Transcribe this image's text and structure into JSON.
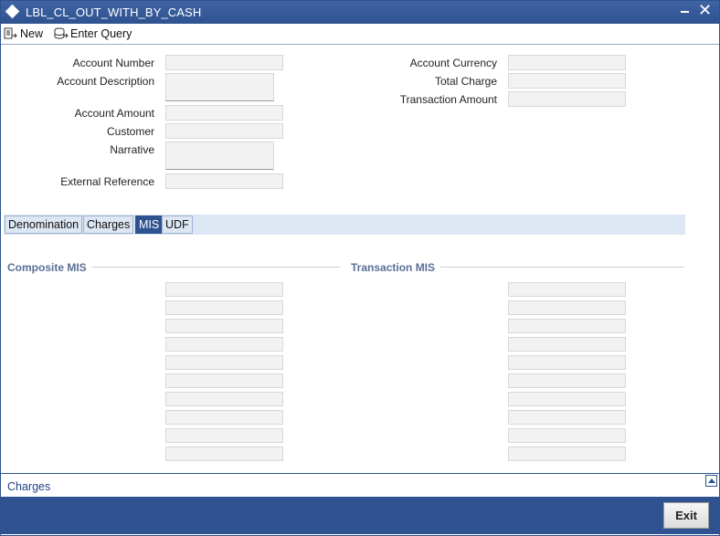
{
  "window": {
    "title": "LBL_CL_OUT_WITH_BY_CASH"
  },
  "toolbar": {
    "new_label": "New",
    "enter_query_label": "Enter Query"
  },
  "form": {
    "left": {
      "account_number": {
        "label": "Account Number",
        "value": ""
      },
      "account_description": {
        "label": "Account Description",
        "value": ""
      },
      "account_amount": {
        "label": "Account Amount",
        "value": ""
      },
      "customer": {
        "label": "Customer",
        "value": ""
      },
      "narrative": {
        "label": "Narrative",
        "value": ""
      },
      "external_reference": {
        "label": "External Reference",
        "value": ""
      }
    },
    "right": {
      "account_currency": {
        "label": "Account Currency",
        "value": ""
      },
      "total_charge": {
        "label": "Total Charge",
        "value": ""
      },
      "transaction_amount": {
        "label": "Transaction Amount",
        "value": ""
      }
    }
  },
  "tabs": [
    {
      "label": "Denomination",
      "active": false
    },
    {
      "label": "Charges",
      "active": false
    },
    {
      "label": "MIS",
      "active": true
    },
    {
      "label": "UDF",
      "active": false
    }
  ],
  "mis": {
    "composite_title": "Composite MIS",
    "transaction_title": "Transaction MIS",
    "composite_fields": [
      "",
      "",
      "",
      "",
      "",
      "",
      "",
      "",
      "",
      ""
    ],
    "transaction_fields": [
      "",
      "",
      "",
      "",
      "",
      "",
      "",
      "",
      "",
      ""
    ]
  },
  "footer": {
    "charges_link": "Charges",
    "exit_label": "Exit"
  },
  "colors": {
    "title_bar": "#2f5390",
    "tab_active": "#2f5390",
    "tab_strip": "#dde6f3"
  }
}
